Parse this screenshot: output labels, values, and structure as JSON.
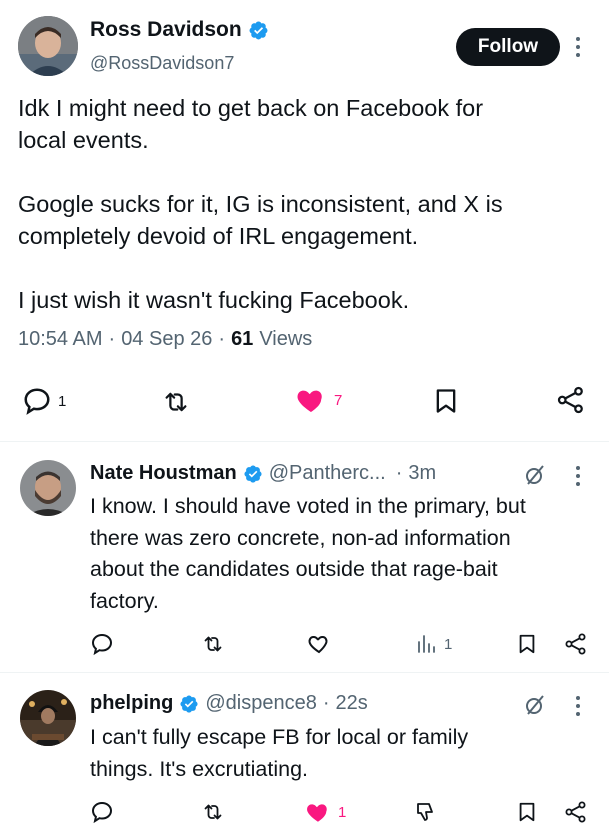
{
  "main_tweet": {
    "name": "Ross Davidson",
    "handle": "@RossDavidson7",
    "follow_label": "Follow",
    "text_lines": [
      "Idk I might need to get back on Facebook for",
      "local events.",
      "",
      "Google sucks for it, IG is inconsistent, and X is",
      "completely devoid of IRL engagement.",
      "",
      "I just wish it wasn't fucking Facebook."
    ],
    "time": "10:54 AM",
    "date": "04 Sep 26",
    "views_count": "61",
    "views_label": "Views",
    "reply_count": "1",
    "like_count": "7"
  },
  "replies": [
    {
      "name": "Nate Houstman",
      "handle": "@Pantherc...",
      "age": "3m",
      "text_lines": [
        "I know. I should have voted in the primary, but",
        "there was zero concrete, non-ad information",
        "about the candidates outside that rage-bait",
        "factory."
      ],
      "views_count": "1"
    },
    {
      "name": "phelping",
      "handle": "@dispence8",
      "age": "22s",
      "text_lines": [
        "I can't fully escape FB for local or family",
        "things. It's excrutiating."
      ],
      "like_count": "1"
    }
  ],
  "colors": {
    "text": "#0f1419",
    "secondary": "#536471",
    "verified": "#1d9bf0",
    "like": "#f91880",
    "follow_bg": "#0f1419"
  }
}
